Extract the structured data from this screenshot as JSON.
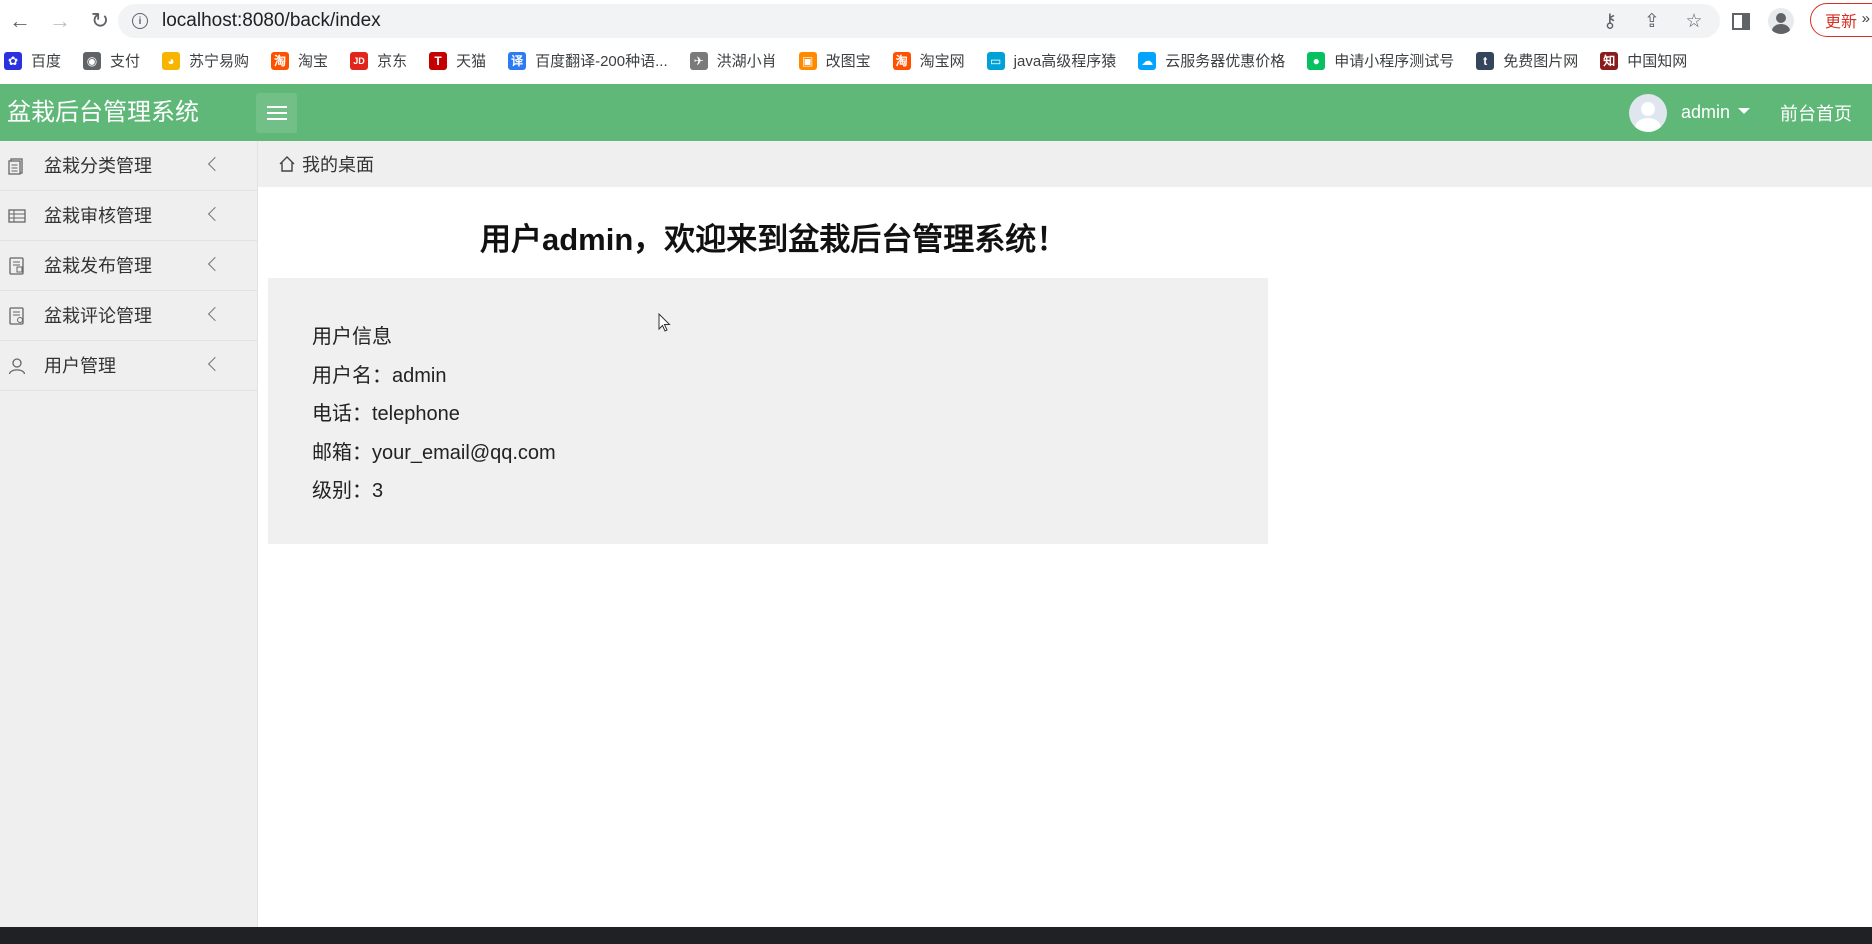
{
  "browser": {
    "url": "localhost:8080/back/index",
    "update_label": "更新"
  },
  "bookmarks": [
    {
      "label": "百度",
      "icon": "paw-icon",
      "color": "#2932e1",
      "glyph": "✿"
    },
    {
      "label": "支付",
      "icon": "globe-icon",
      "color": "#5f6368",
      "glyph": "◉"
    },
    {
      "label": "苏宁易购",
      "icon": "suning-icon",
      "color": "#f7b500",
      "glyph": "◕"
    },
    {
      "label": "淘宝",
      "icon": "taobao-icon",
      "color": "#ff5000",
      "glyph": "淘"
    },
    {
      "label": "京东",
      "icon": "jd-icon",
      "color": "#e1251b",
      "glyph": "JD"
    },
    {
      "label": "天猫",
      "icon": "tmall-icon",
      "color": "#c40000",
      "glyph": "T"
    },
    {
      "label": "百度翻译-200种语...",
      "icon": "translate-icon",
      "color": "#2d7bf4",
      "glyph": "译"
    },
    {
      "label": "洪湖小肖",
      "icon": "bird-icon",
      "color": "#7a7a7a",
      "glyph": "✈"
    },
    {
      "label": "改图宝",
      "icon": "image-tool-icon",
      "color": "#ff8a00",
      "glyph": "▣"
    },
    {
      "label": "淘宝网",
      "icon": "taobao-icon",
      "color": "#ff5000",
      "glyph": "淘"
    },
    {
      "label": "java高级程序猿",
      "icon": "bilibili-icon",
      "color": "#00a1d6",
      "glyph": "▭"
    },
    {
      "label": "云服务器优惠价格",
      "icon": "cloud-icon",
      "color": "#00a4ff",
      "glyph": "☁"
    },
    {
      "label": "申请小程序测试号",
      "icon": "wechat-icon",
      "color": "#07c160",
      "glyph": "●"
    },
    {
      "label": "免费图片网",
      "icon": "tumblr-icon",
      "color": "#35465c",
      "glyph": "t"
    },
    {
      "label": "中国知网",
      "icon": "cnki-icon",
      "color": "#8a1c1c",
      "glyph": "知"
    }
  ],
  "header": {
    "title": "盆栽后台管理系统",
    "user": "admin",
    "front_home": "前台首页"
  },
  "sidebar": {
    "items": [
      {
        "label": "盆栽分类管理",
        "icon": "document-icon"
      },
      {
        "label": "盆栽审核管理",
        "icon": "table-icon"
      },
      {
        "label": "盆栽发布管理",
        "icon": "publish-icon"
      },
      {
        "label": "盆栽评论管理",
        "icon": "comment-icon"
      },
      {
        "label": "用户管理",
        "icon": "user-icon"
      }
    ]
  },
  "breadcrumb": {
    "label": "我的桌面"
  },
  "main": {
    "welcome": "用户admin，欢迎来到盆栽后台管理系统！",
    "info_title": "用户信息",
    "username": "用户名：admin",
    "phone": "电话：telephone",
    "email": "邮箱：your_email@qq.com",
    "level": "级别：3"
  },
  "colors": {
    "header_bg": "#5fb878",
    "sidebar_bg": "#efefef",
    "panel_bg": "#f0f0f0"
  }
}
